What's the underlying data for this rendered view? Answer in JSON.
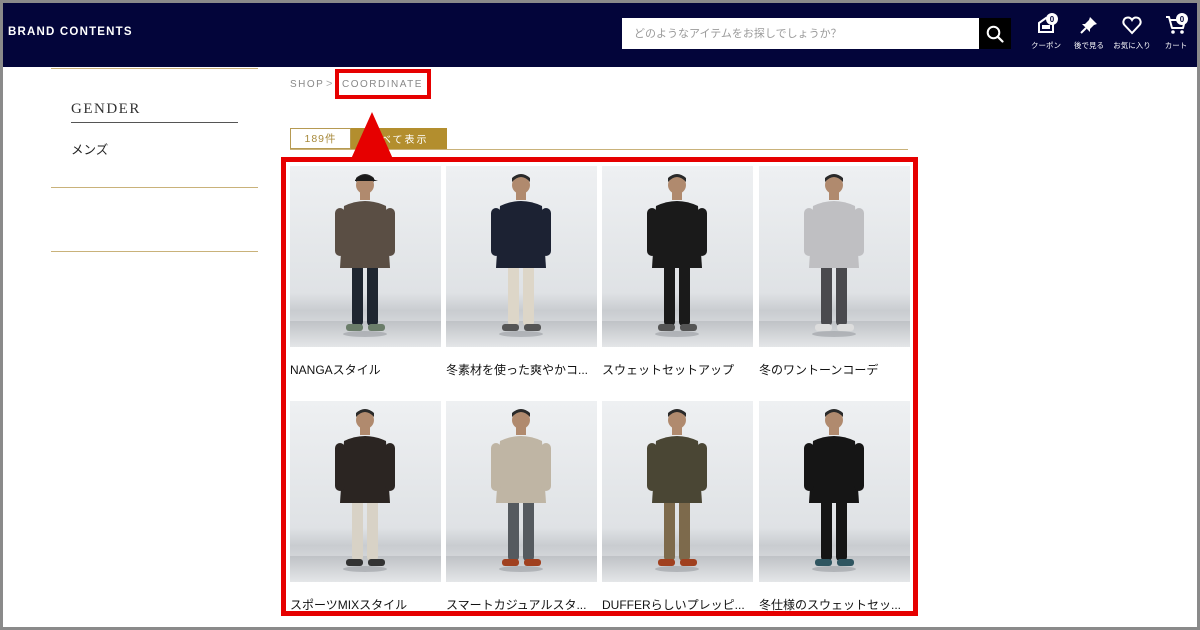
{
  "header": {
    "brand": "BRAND CONTENTS",
    "search_placeholder": "どのようなアイテムをお探しでしょうか？",
    "icons": [
      {
        "name": "coupon-icon",
        "label": "クーポン",
        "badge": "0"
      },
      {
        "name": "pin-icon",
        "label": "後で見る",
        "badge": ""
      },
      {
        "name": "heart-icon",
        "label": "お気に入り",
        "badge": ""
      },
      {
        "name": "cart-icon",
        "label": "カート",
        "badge": "0"
      }
    ]
  },
  "sidebar": {
    "title": "GENDER",
    "items": [
      "メンズ"
    ]
  },
  "breadcrumb": {
    "root": "SHOP",
    "separator": ">",
    "current": "COORDINATE"
  },
  "results": {
    "count": "189件",
    "tab_label": "すべて表示"
  },
  "items": [
    {
      "title": "NANGAスタイル",
      "outfit": "jacket-brown"
    },
    {
      "title": "冬素材を使った爽やかコ...",
      "outfit": "navy-knit"
    },
    {
      "title": "スウェットセットアップ",
      "outfit": "black-setup"
    },
    {
      "title": "冬のワントーンコーデ",
      "outfit": "grey-hoodie"
    },
    {
      "title": "スポーツMIXスタイル",
      "outfit": "black-jacket"
    },
    {
      "title": "スマートカジュアルスタ...",
      "outfit": "beige-knit"
    },
    {
      "title": "DUFFERらしいプレッピ...",
      "outfit": "olive-varsity"
    },
    {
      "title": "冬仕様のスウェットセッ...",
      "outfit": "black-hoodie"
    }
  ],
  "colors": {
    "header_bg": "#03053a",
    "accent_gold": "#b38e2e",
    "highlight_red": "#e60000"
  }
}
